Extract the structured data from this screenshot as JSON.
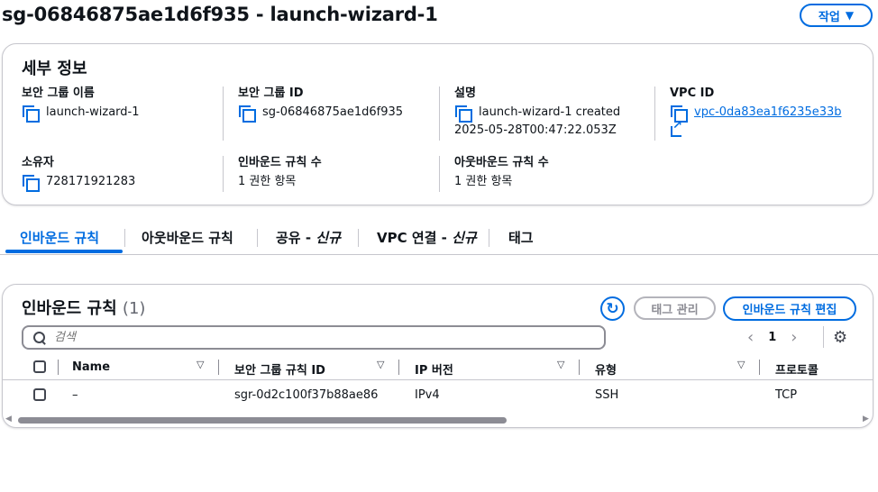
{
  "page": {
    "title": "sg-06846875ae1d6f935 - launch-wizard-1",
    "action_label": "작업"
  },
  "details": {
    "title": "세부 정보",
    "sg_name": {
      "label": "보안 그룹 이름",
      "value": "launch-wizard-1"
    },
    "sg_id": {
      "label": "보안 그룹 ID",
      "value": "sg-06846875ae1d6f935"
    },
    "description": {
      "label": "설명",
      "value_line1": "launch-wizard-1 created",
      "value_line2": "2025-05-28T00:47:22.053Z"
    },
    "vpc_id": {
      "label": "VPC ID",
      "value": "vpc-0da83ea1f6235e33b"
    },
    "owner": {
      "label": "소유자",
      "value": "728171921283"
    },
    "inbound_count": {
      "label": "인바운드 규칙 수",
      "value": "1 권한 항목"
    },
    "outbound_count": {
      "label": "아웃바운드 규칙 수",
      "value": "1 권한 항목"
    }
  },
  "tabs": [
    {
      "label": "인바운드 규칙",
      "italic": ""
    },
    {
      "label": "아웃바운드 규칙",
      "italic": ""
    },
    {
      "label": "공유 - ",
      "italic": "신규"
    },
    {
      "label": "VPC 연결 - ",
      "italic": "신규"
    },
    {
      "label": "태그",
      "italic": ""
    }
  ],
  "rules": {
    "title": "인바운드 규칙",
    "count": "(1)",
    "manage_tags_label": "태그 관리",
    "edit_label": "인바운드 규칙 편집",
    "search_placeholder": "검색",
    "page_number": "1",
    "columns": [
      "Name",
      "보안 그룹 규칙 ID",
      "IP 버전",
      "유형",
      "프로토콜"
    ],
    "rows": [
      {
        "name": "–",
        "rule_id": "sgr-0d2c100f37b88ae86",
        "ip_version": "IPv4",
        "type": "SSH",
        "protocol": "TCP"
      }
    ],
    "scroll_position_fraction": 0.57
  },
  "colors": {
    "accent": "#006ce0",
    "border": "#c6c6cd",
    "text": "#0f141a",
    "disabled": "#8c8c94"
  }
}
